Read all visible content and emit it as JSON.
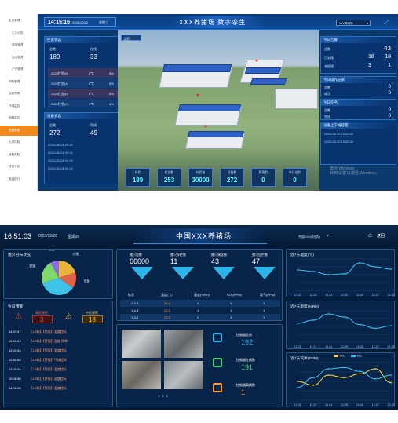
{
  "top_dashboard": {
    "time": "14:15:16",
    "date": "2025/10/22",
    "weekday": "星期三",
    "title": "XXX养猪场 数字孪生",
    "farm_select": "XXX养猪场",
    "sidebar": {
      "items": [
        {
          "label": "生长管理",
          "type": "group"
        },
        {
          "label": "生长记录",
          "type": "sub"
        },
        {
          "label": "母猪管理",
          "type": "sub"
        },
        {
          "label": "免疫管理",
          "type": "sub"
        },
        {
          "label": "产仔管理",
          "type": "sub"
        },
        {
          "label": "饲料管理",
          "type": "group"
        },
        {
          "label": "疾病预警",
          "type": "group"
        },
        {
          "label": "环境监控",
          "type": "group"
        },
        {
          "label": "视频监控",
          "type": "group"
        },
        {
          "label": "数据看板",
          "type": "group",
          "active": true
        },
        {
          "label": "人员风险",
          "type": "group"
        },
        {
          "label": "设备风险",
          "type": "group"
        },
        {
          "label": "财务分析",
          "type": "group"
        },
        {
          "label": "电量统计",
          "type": "group"
        }
      ]
    },
    "device_panel": {
      "title": "栏舍状态",
      "cols": [
        "总数",
        "在线"
      ],
      "values": [
        "189",
        "33"
      ],
      "rows": [
        {
          "name": "2023栏舍(B)",
          "temp": "8℃",
          "hum": "8%"
        },
        {
          "name": "2024栏舍(A)",
          "temp": "8℃",
          "hum": "8%"
        },
        {
          "name": "2025栏舍(B)",
          "temp": "8℃",
          "hum": "8%"
        },
        {
          "name": "2026栏舍(C)",
          "temp": "8℃",
          "hum": "8%"
        }
      ]
    },
    "equip_panel": {
      "title": "设备状态",
      "cols": [
        "总数",
        "离线"
      ],
      "values": [
        "272",
        "49"
      ],
      "logs": [
        "2024-06-24 09:18",
        "2024-06-24 09:18",
        "2024-06-24 09:18",
        "2024-06-24 09:18"
      ]
    },
    "back_label": "返回",
    "right_panels": {
      "alarm": {
        "title": "今日告警",
        "big": "43",
        "rows": [
          {
            "k": "总数",
            "a": "",
            "b": ""
          },
          {
            "k": "已处理",
            "a": "16",
            "b": "19"
          },
          {
            "k": "未处理",
            "a": "3",
            "b": "1"
          }
        ]
      },
      "records": {
        "title": "今日操作记录",
        "rows": [
          {
            "k": "总数",
            "v": "0"
          },
          {
            "k": "成功",
            "v": "0"
          }
        ]
      },
      "tasks": {
        "title": "今日任务",
        "rows": [
          {
            "k": "总数",
            "v": "0"
          },
          {
            "k": "完成",
            "v": "0"
          }
        ]
      },
      "online": {
        "title": "设备上下线提醒",
        "rows": [
          "2025-06-30 13:52:09",
          "2025-06-30 13:52:09"
        ]
      }
    },
    "stats": [
      {
        "label": "存栏",
        "value": "189"
      },
      {
        "label": "栏位数",
        "value": "253"
      },
      {
        "label": "存栏量",
        "value": "30000"
      },
      {
        "label": "设备数",
        "value": "272"
      },
      {
        "label": "隔离栏",
        "value": "0"
      },
      {
        "label": "今日出栏",
        "value": "0"
      }
    ],
    "watermark": "激活 Windows\n转到'设置'以激活 Windows。"
  },
  "bottom_dashboard": {
    "time": "16:51:03",
    "date": "2023/12/28",
    "weekday": "星期四",
    "title": "中国XXX养猪场",
    "farm_select": "中国XXX养猪场",
    "back_label": "返回",
    "pie": {
      "title": "猪只分布状况",
      "labels": [
        "公猪",
        "母猪",
        "仔猪",
        "肥猪",
        "后备"
      ],
      "values": [
        20,
        15,
        35,
        22,
        8
      ],
      "colors": [
        "#e8b43a",
        "#e0624a",
        "#3fc2e8",
        "#7ed86a",
        "#8a6ae8"
      ]
    },
    "alarm": {
      "title": "今日预警",
      "high_label": "高危预警",
      "high_value": "3",
      "mid_label": "中危预警",
      "mid_value": "18",
      "logs": [
        {
          "time": "14:37:47",
          "text": "【1-3栋】【警报】温度超标"
        },
        {
          "time": "05:01:23",
          "text": "【1-3栋】【警报】湿度 异常"
        },
        {
          "time": "12:01:54",
          "text": "【1-3栋】【警报】温度超标"
        },
        {
          "time": "12:51:54",
          "text": "【1-3栋】【警报】气体超标"
        },
        {
          "time": "12:01:04",
          "text": "【1-3栋】【警报】温度超标"
        },
        {
          "time": "10:08:58",
          "text": "【1-3栋】【警报】温度超标"
        },
        {
          "time": "14:08:08",
          "text": "【1-3栋】【警报】温度超标"
        }
      ]
    },
    "counts": [
      {
        "label": "猪只总数",
        "value": "66000"
      },
      {
        "label": "猪只存栏数",
        "value": "11"
      },
      {
        "label": "猪只淘汰数",
        "value": "43"
      },
      {
        "label": "猪只出栏数",
        "value": "47"
      }
    ],
    "env_table": {
      "headers": [
        "栋舍",
        "温度(℃)",
        "湿度(%RH)",
        "CO₂(PPM)",
        "氨气(PPM)"
      ],
      "rows": [
        [
          "1-4-3",
          "25.1",
          "1",
          "1",
          "1"
        ],
        [
          "1-4-3",
          "22.5",
          "1",
          "1",
          "1"
        ],
        [
          "1-3-2",
          "22.5",
          "1",
          "1",
          "1"
        ]
      ]
    },
    "controls": [
      {
        "label": "控制器总数",
        "value": "192"
      },
      {
        "label": "控制器在线数",
        "value": "191"
      },
      {
        "label": "控制器离线数",
        "value": "1"
      }
    ],
    "chart_data": [
      {
        "type": "line",
        "title": "近7天温度(℃)",
        "x": [
          "12-22",
          "12-23",
          "12-24",
          "12-25",
          "12-26",
          "12-27",
          "12-28"
        ],
        "series": [
          {
            "values": [
              26,
              24,
              20,
              21,
              35,
              30,
              27
            ]
          }
        ],
        "ylim": [
          0,
          40
        ]
      },
      {
        "type": "line",
        "title": "近7天湿度(%RH)",
        "x": [
          "12-22",
          "12-23",
          "12-24",
          "12-25",
          "12-26",
          "12-27",
          "12-28"
        ],
        "series": [
          {
            "values": [
              30,
              35,
              45,
              40,
              28,
              22,
              26
            ]
          }
        ],
        "ylim": [
          0,
          50
        ]
      },
      {
        "type": "line",
        "title": "近7天气体(PPM)",
        "x": [
          "12-22",
          "12-23",
          "12-24",
          "12-25",
          "12-26",
          "12-27",
          "12-28"
        ],
        "series": [
          {
            "name": "CO₂",
            "values": [
              150,
              120,
              200,
              180,
              210,
              250,
              140
            ]
          },
          {
            "name": "NH₃",
            "values": [
              100,
              180,
              250,
              260,
              230,
              170,
              200
            ]
          }
        ],
        "ylim": [
          0,
          300
        ]
      }
    ]
  }
}
